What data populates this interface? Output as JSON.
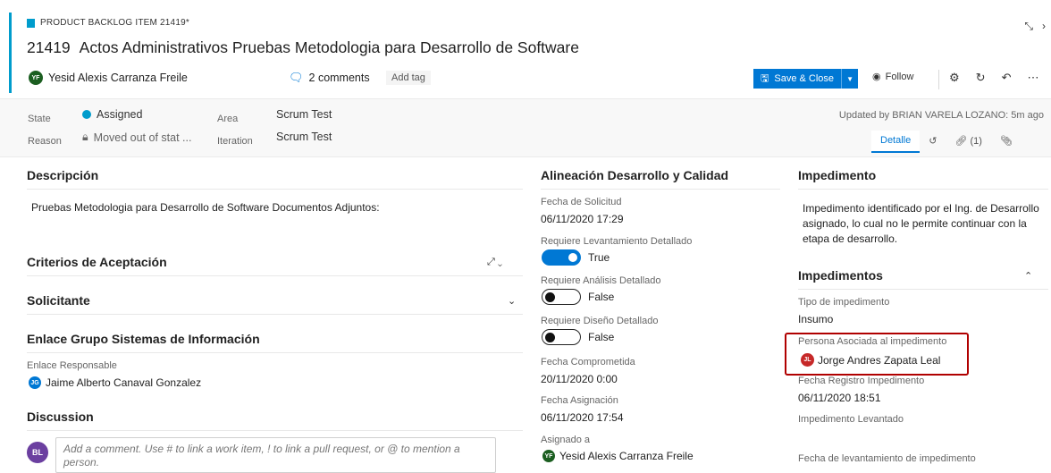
{
  "header": {
    "type_label": "PRODUCT BACKLOG ITEM 21419*",
    "id": "21419",
    "title": "Actos Administrativos Pruebas Metodologia para Desarrollo de Software",
    "owner_initials": "YF",
    "owner": "Yesid Alexis Carranza Freile",
    "comments": "2 comments",
    "add_tag": "Add tag",
    "save_label": "Save & Close",
    "follow_label": "Follow"
  },
  "fields": {
    "state_label": "State",
    "state_value": "Assigned",
    "reason_label": "Reason",
    "reason_value": "Moved out of stat ...",
    "area_label": "Area",
    "area_value": "Scrum Test",
    "iteration_label": "Iteration",
    "iteration_value": "Scrum Test",
    "updated": "Updated by BRIAN VARELA LOZANO: 5m ago"
  },
  "tabs": {
    "detalle": "Detalle",
    "links": "(1)"
  },
  "left": {
    "descripcion_title": "Descripción",
    "descripcion_text": "Pruebas Metodologia para Desarrollo de Software Documentos Adjuntos:",
    "criterios_title": "Criterios de Aceptación",
    "solicitante_title": "Solicitante",
    "enlace_title": "Enlace Grupo Sistemas de Información",
    "enlace_resp_label": "Enlace Responsable",
    "enlace_resp_initials": "JG",
    "enlace_resp_value": "Jaime Alberto Canaval Gonzalez",
    "discussion_title": "Discussion",
    "comment_avatar": "BL",
    "comment_placeholder": "Add a comment. Use # to link a work item, ! to link a pull request, or @ to mention a person."
  },
  "middle": {
    "title": "Alineación Desarrollo y Calidad",
    "fecha_solicitud_label": "Fecha de Solicitud",
    "fecha_solicitud_value": "06/11/2020 17:29",
    "req_lev_label": "Requiere Levantamiento Detallado",
    "req_lev_value": "True",
    "req_ana_label": "Requiere Análisis Detallado",
    "req_ana_value": "False",
    "req_dis_label": "Requiere Diseño Detallado",
    "req_dis_value": "False",
    "fecha_comp_label": "Fecha Comprometida",
    "fecha_comp_value": "20/11/2020 0:00",
    "fecha_asig_label": "Fecha Asignación",
    "fecha_asig_value": "06/11/2020 17:54",
    "asignado_label": "Asignado a",
    "asignado_initials": "YF",
    "asignado_value": "Yesid Alexis Carranza Freile"
  },
  "right": {
    "impedimento_title": "Impedimento",
    "impedimento_text": "Impedimento identificado por el Ing. de Desarrollo asignado, lo cual no le permite continuar con la etapa de desarrollo.",
    "impedimentos_title": "Impedimentos",
    "tipo_label": "Tipo de impedimento",
    "tipo_value": "Insumo",
    "persona_label": "Persona Asociada al impedimento",
    "persona_initials": "JL",
    "persona_value": "Jorge Andres Zapata Leal",
    "fecha_reg_label": "Fecha Registro Impedimento",
    "fecha_reg_value": "06/11/2020 18:51",
    "imp_lev_label": "Impedimento Levantado",
    "fecha_lev_label": "Fecha de levantamiento de impedimento"
  },
  "colors": {
    "accent": "#009ccc",
    "primary": "#0078d4",
    "highlight_border": "#b00000"
  }
}
